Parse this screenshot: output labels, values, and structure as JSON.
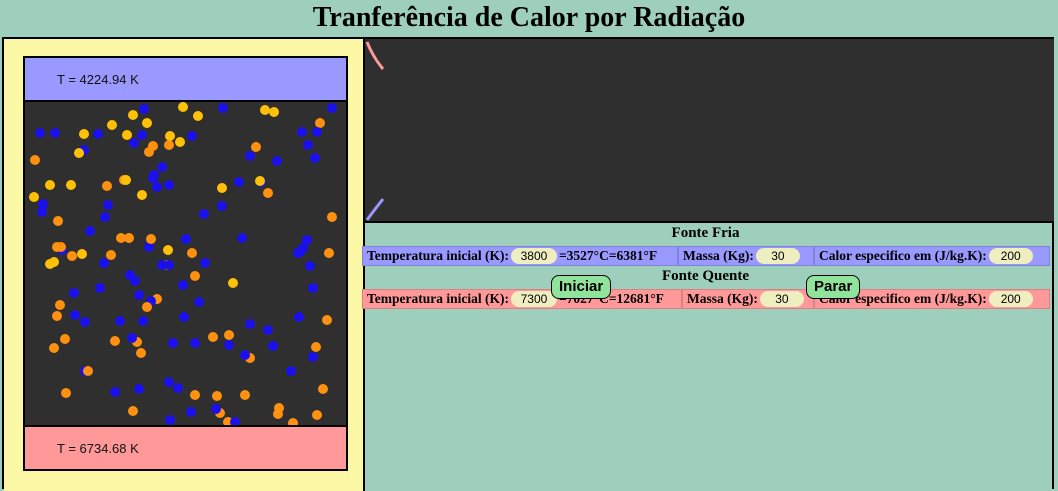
{
  "title": "Tranferência de Calor por Radiação",
  "simulation": {
    "cold_plate_label": "T = 4224.94 K",
    "hot_plate_label": "T = 6734.68 K",
    "colors": {
      "cold_plate": "#9999ff",
      "hot_plate": "#ff9999",
      "particle_blue": "#1a10ee",
      "particle_gold": "#ffc107",
      "particle_orange": "#ff9010",
      "background": "#2f2f2f"
    }
  },
  "cold_source": {
    "heading": "Fonte Fria",
    "temp_label": "Temperatura inicial (K):",
    "temp_value": "3800",
    "temp_conversion": "=3527°C=6381°F",
    "mass_label": "Massa (Kg):",
    "mass_value": "30",
    "specific_heat_label": "Calor especifico em (J/kg.K):",
    "specific_heat_value": "200"
  },
  "hot_source": {
    "heading": "Fonte Quente",
    "temp_label": "Temperatura inicial (K):",
    "temp_value": "7300",
    "temp_conversion": "=7027°C=12681°F",
    "mass_label": "Massa (Kg):",
    "mass_value": "30",
    "specific_heat_label": "Calor especifico em (J/kg.K):",
    "specific_heat_value": "200"
  },
  "controls": {
    "start_label": "Iniciar",
    "stop_label": "Parar"
  }
}
